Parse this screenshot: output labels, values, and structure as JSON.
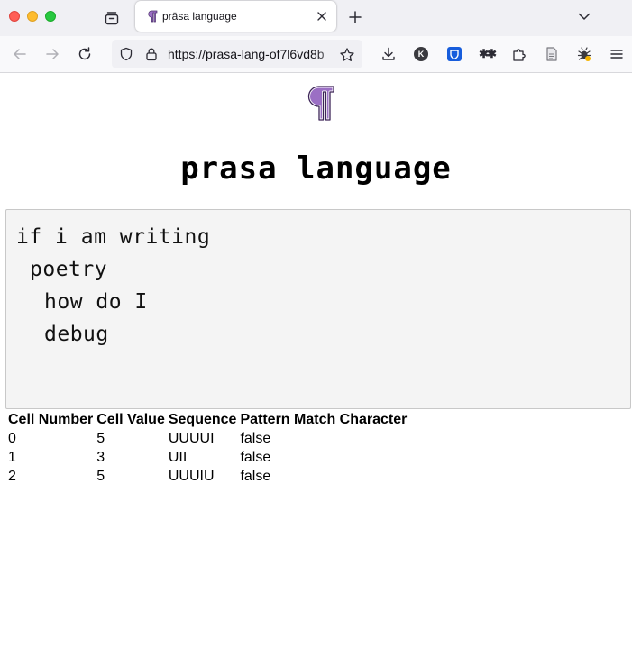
{
  "browser": {
    "tab_title": "prāsa language",
    "url": "https://prasa-lang-of7l6vd8b",
    "extensions": {
      "k_label": "K"
    }
  },
  "page": {
    "heading": "prasa language",
    "editor_lines": [
      "if i am writing",
      "poetry",
      "how do I",
      "debug"
    ]
  },
  "table": {
    "headers": [
      "Cell Number",
      "Cell Value",
      "Sequence",
      "Pattern Match Character"
    ],
    "rows": [
      [
        "0",
        "5",
        "UUUUI",
        "false"
      ],
      [
        "1",
        "3",
        "UII",
        "false"
      ],
      [
        "2",
        "5",
        "UUUIU",
        "false"
      ]
    ]
  },
  "colors": {
    "logo_fill": "#9b6fc4",
    "tab_bar": "#f0f0f4",
    "editor_bg": "#f4f4f4"
  }
}
